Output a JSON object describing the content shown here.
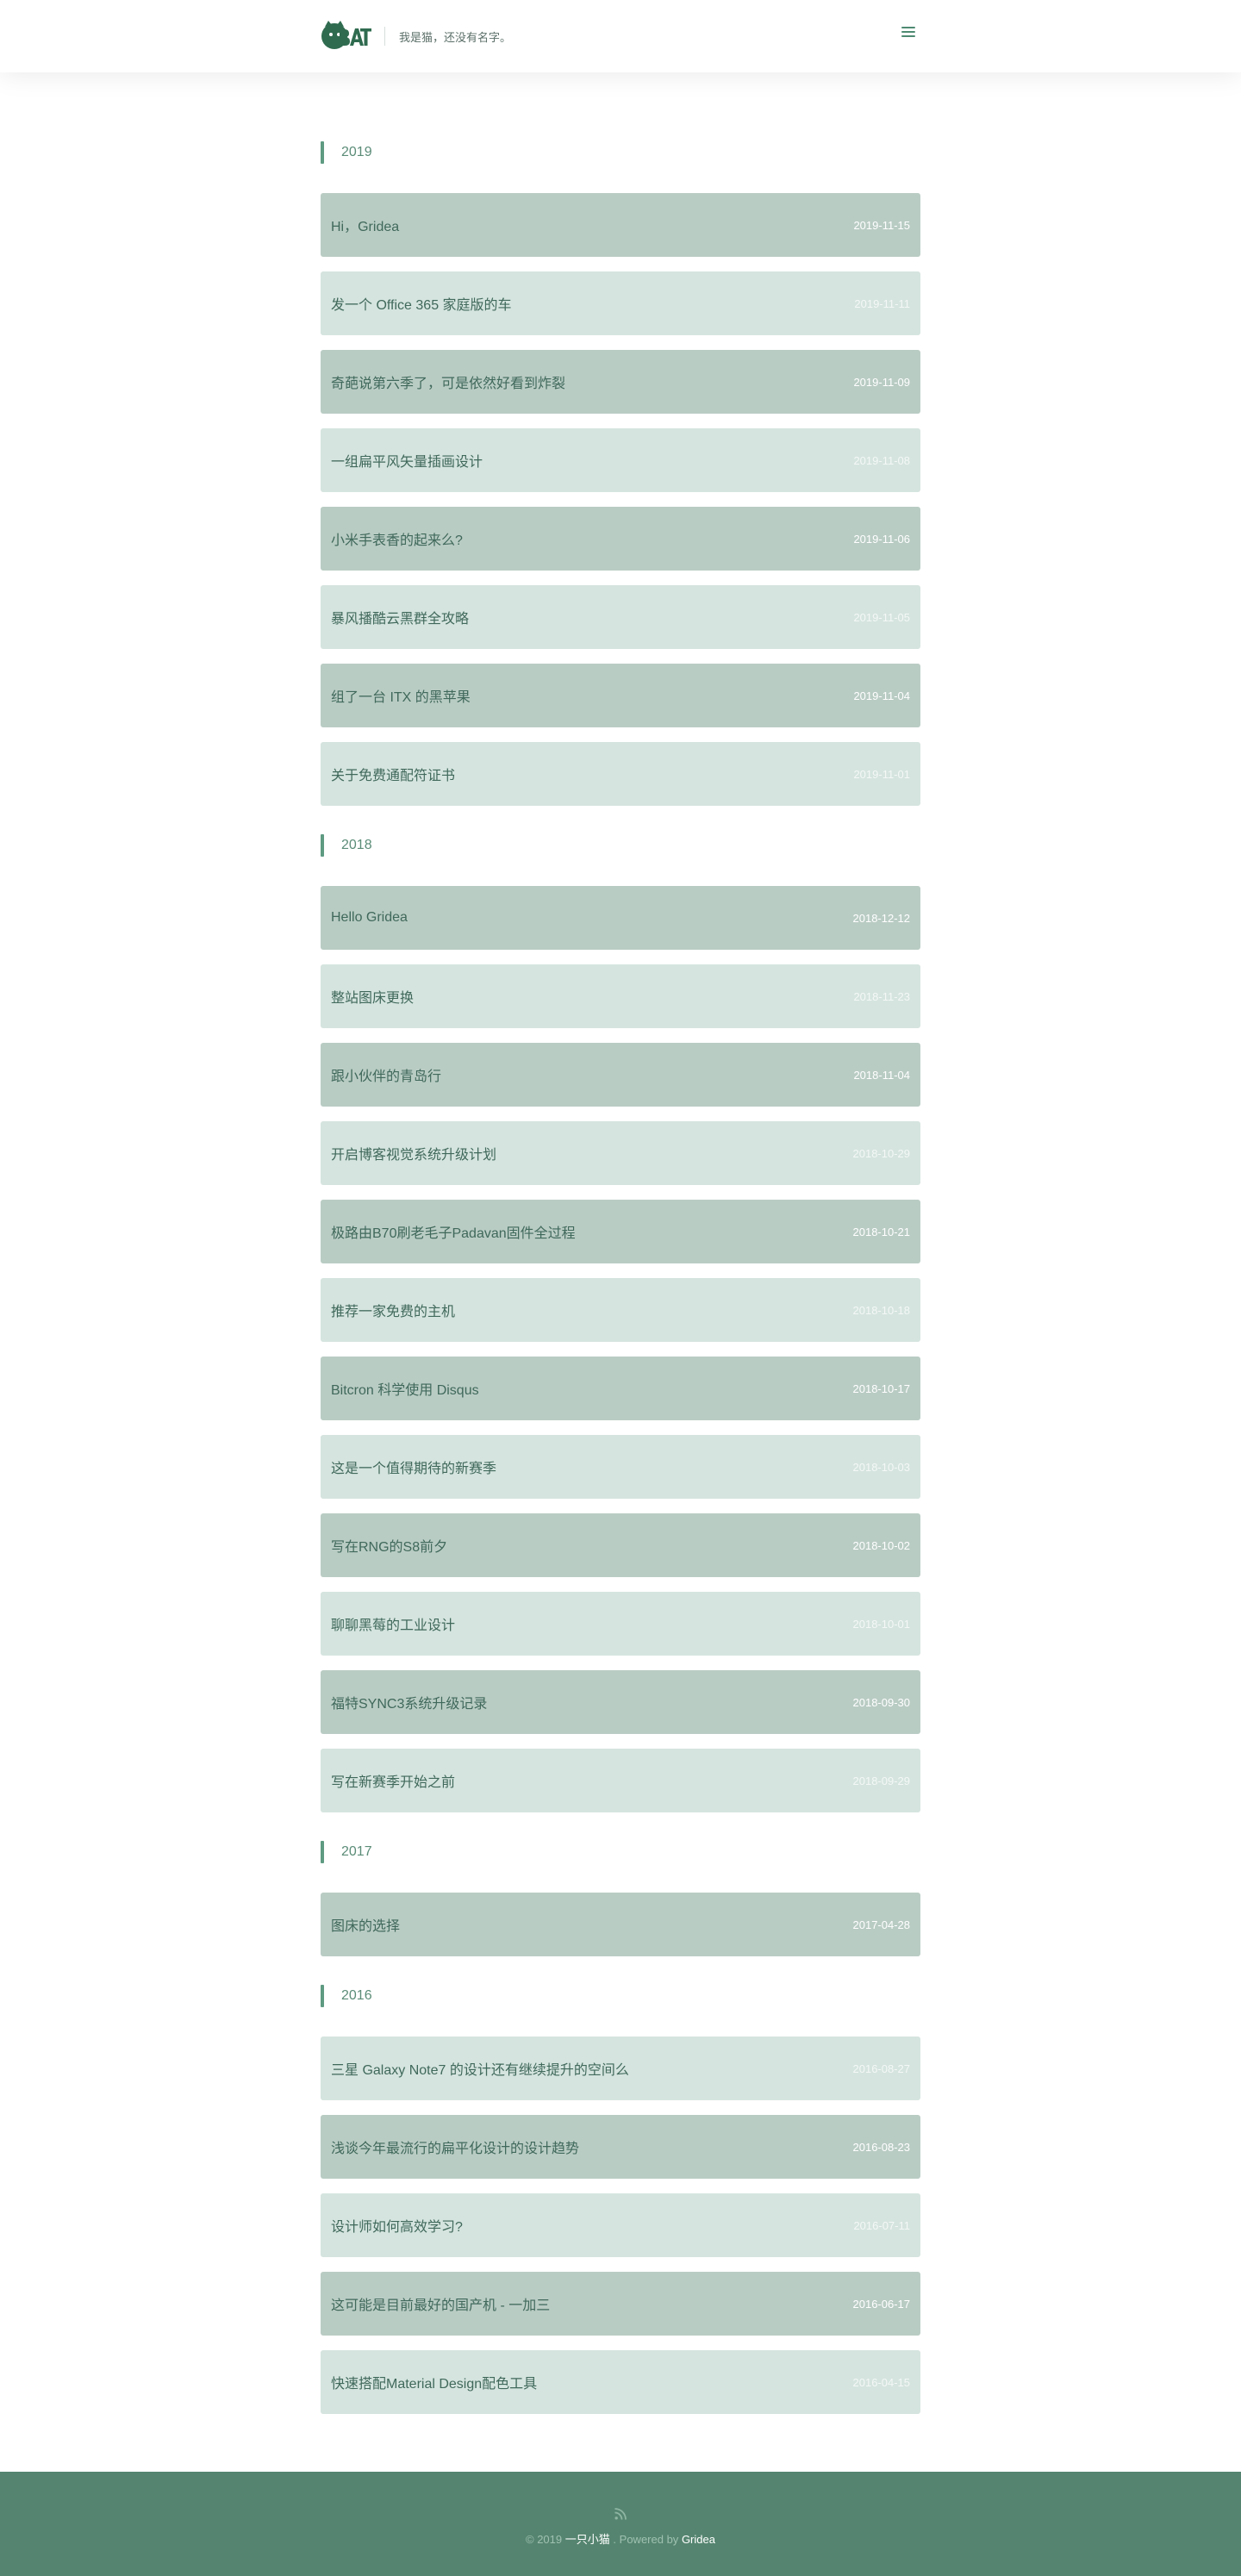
{
  "header": {
    "tagline": "我是猫，还没有名字。"
  },
  "groups": [
    {
      "year": "2019",
      "posts": [
        {
          "title": "Hi，Gridea",
          "date": "2019-11-15"
        },
        {
          "title": "发一个 Office 365 家庭版的车",
          "date": "2019-11-11"
        },
        {
          "title": "奇葩说第六季了，可是依然好看到炸裂",
          "date": "2019-11-09"
        },
        {
          "title": "一组扁平风矢量插画设计",
          "date": "2019-11-08"
        },
        {
          "title": "小米手表香的起来么?",
          "date": "2019-11-06"
        },
        {
          "title": "暴风播酷云黑群全攻略",
          "date": "2019-11-05"
        },
        {
          "title": "组了一台 ITX 的黑苹果",
          "date": "2019-11-04"
        },
        {
          "title": "关于免费通配符证书",
          "date": "2019-11-01"
        }
      ]
    },
    {
      "year": "2018",
      "posts": [
        {
          "title": "Hello Gridea",
          "date": "2018-12-12"
        },
        {
          "title": "整站图床更换",
          "date": "2018-11-23"
        },
        {
          "title": "跟小伙伴的青岛行",
          "date": "2018-11-04"
        },
        {
          "title": "开启博客视觉系统升级计划",
          "date": "2018-10-29"
        },
        {
          "title": "极路由B70刷老毛子Padavan固件全过程",
          "date": "2018-10-21"
        },
        {
          "title": "推荐一家免费的主机",
          "date": "2018-10-18"
        },
        {
          "title": "Bitcron 科学使用 Disqus",
          "date": "2018-10-17"
        },
        {
          "title": "这是一个值得期待的新赛季",
          "date": "2018-10-03"
        },
        {
          "title": "写在RNG的S8前夕",
          "date": "2018-10-02"
        },
        {
          "title": "聊聊黑莓的工业设计",
          "date": "2018-10-01"
        },
        {
          "title": "福特SYNC3系统升级记录",
          "date": "2018-09-30"
        },
        {
          "title": "写在新赛季开始之前",
          "date": "2018-09-29"
        }
      ]
    },
    {
      "year": "2017",
      "posts": [
        {
          "title": "图床的选择",
          "date": "2017-04-28"
        }
      ]
    },
    {
      "year": "2016",
      "posts": [
        {
          "title": "三星 Galaxy Note7 的设计还有继续提升的空间么",
          "date": "2016-08-27"
        },
        {
          "title": "浅谈今年最流行的扁平化设计的设计趋势",
          "date": "2016-08-23"
        },
        {
          "title": "设计师如何高效学习?",
          "date": "2016-07-11"
        },
        {
          "title": "这可能是目前最好的国产机 - 一加三",
          "date": "2016-06-17"
        },
        {
          "title": "快速搭配Material Design配色工具",
          "date": "2016-04-15"
        }
      ]
    }
  ],
  "footer": {
    "copyright": "© 2019",
    "author": "一只小猫",
    "separator": ".",
    "powered_by": "Powered by",
    "engine": "Gridea"
  },
  "colors": {
    "accent": "#5e9b82",
    "card_dark": "#b9ccc4",
    "card_light": "#d5e4df",
    "footer_bg": "#558570"
  },
  "icons": {
    "menu": "hamburger-menu-icon",
    "rss": "rss-icon"
  }
}
